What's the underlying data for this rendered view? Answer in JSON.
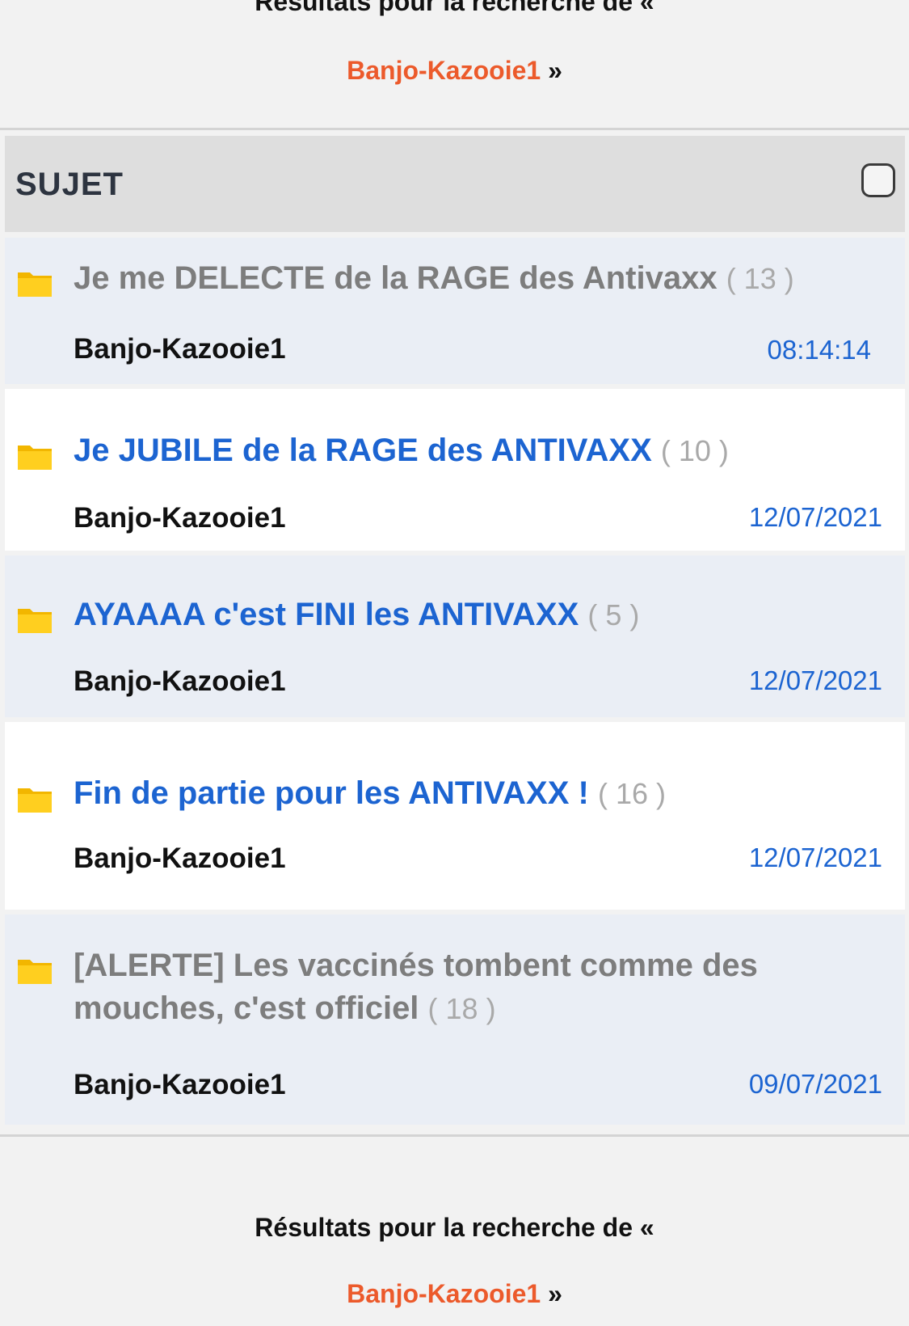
{
  "search_banner": {
    "prefix": "Résultats pour la recherche de «",
    "query": "Banjo-Kazooie1",
    "suffix": " »"
  },
  "table": {
    "header": "SUJET"
  },
  "topics": [
    {
      "title": "Je me DELECTE de la RAGE des Antivaxx",
      "replies": "( 13 )",
      "author": "Banjo-Kazooie1",
      "date": "08:14:14",
      "state": "read"
    },
    {
      "title": "Je JUBILE de la RAGE des ANTIVAXX",
      "replies": "( 10 )",
      "author": "Banjo-Kazooie1",
      "date": "12/07/2021",
      "state": "unread"
    },
    {
      "title": "AYAAAA c'est FINI les ANTIVAXX",
      "replies": "( 5 )",
      "author": "Banjo-Kazooie1",
      "date": "12/07/2021",
      "state": "unread"
    },
    {
      "title": "Fin de partie pour les ANTIVAXX !",
      "replies": "( 16 )",
      "author": "Banjo-Kazooie1",
      "date": "12/07/2021",
      "state": "unread"
    },
    {
      "title": "[ALERTE] Les vaccinés tombent comme des mouches, c'est officiel",
      "replies": "( 18 )",
      "author": "Banjo-Kazooie1",
      "date": "09/07/2021",
      "state": "read"
    }
  ],
  "icons": {
    "topic": "folder-icon",
    "select_all": "checkbox-icon"
  },
  "colors": {
    "query": "#ec5a2b",
    "unread_title": "#1c64d1",
    "read_title": "#7d7d7d",
    "date": "#1c64d1",
    "folder": "#ffcc1a"
  }
}
